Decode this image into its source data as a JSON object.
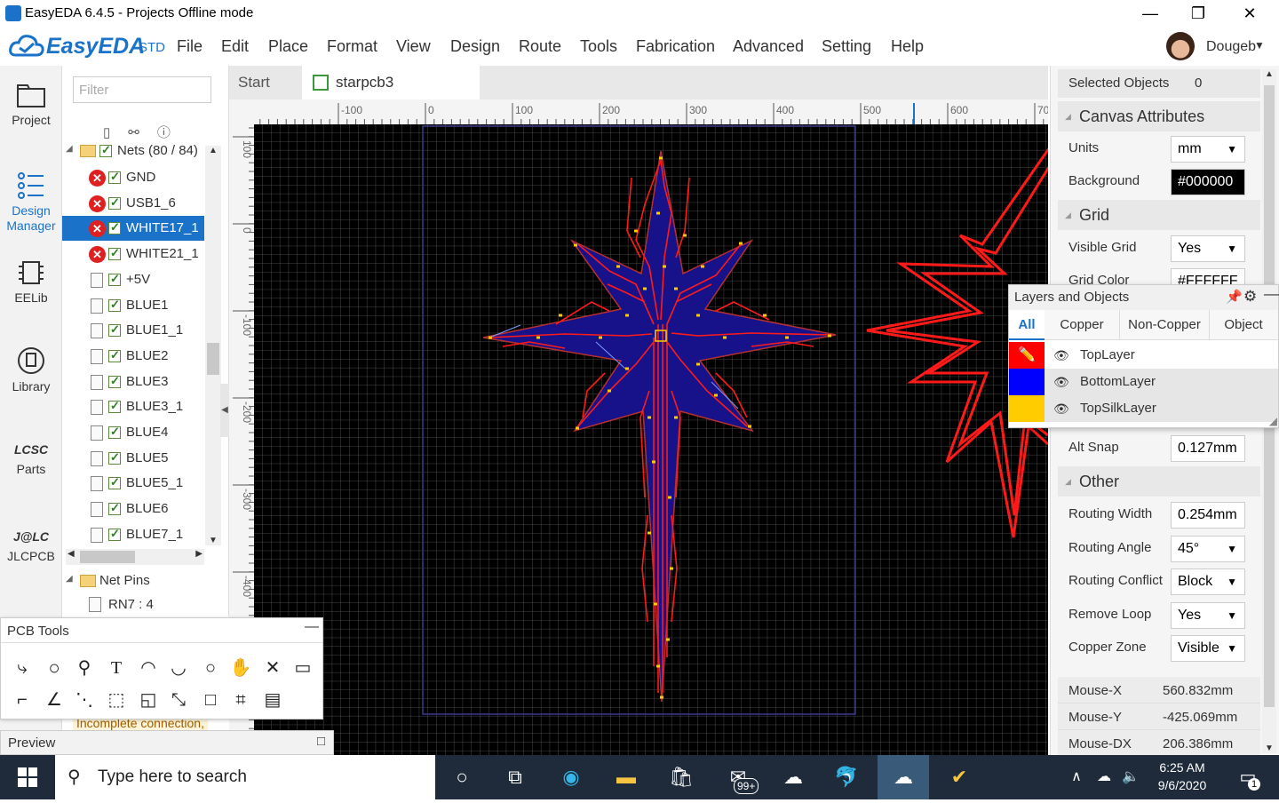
{
  "window": {
    "title": "EasyEDA 6.4.5 - Projects Offline mode",
    "min": "—",
    "max": "❐",
    "close": "✕"
  },
  "menubar": {
    "logo": "EasyEDA",
    "edition": "STD",
    "items": [
      "File",
      "Edit",
      "Place",
      "Format",
      "View",
      "Design",
      "Route",
      "Tools",
      "Fabrication",
      "Advanced",
      "Setting",
      "Help"
    ],
    "user": "Dougeb"
  },
  "leftnav": [
    {
      "label": "Project",
      "icon": "folder-icon"
    },
    {
      "label": "Design Manager",
      "icon": "design-manager-icon"
    },
    {
      "label": "EELib",
      "icon": "chip-icon"
    },
    {
      "label": "Library",
      "icon": "library-icon"
    },
    {
      "label": "Parts",
      "icon": "lcsc-icon"
    },
    {
      "label": "JLCPCB",
      "icon": "jlc-icon"
    }
  ],
  "design_manager": {
    "filter_placeholder": "Filter",
    "nets_header": "Nets (80 / 84)",
    "nets": [
      {
        "name": "GND",
        "error": true
      },
      {
        "name": "USB1_6",
        "error": true
      },
      {
        "name": "WHITE17_1",
        "error": true,
        "selected": true
      },
      {
        "name": "WHITE21_1",
        "error": true
      },
      {
        "name": "+5V",
        "error": false
      },
      {
        "name": "BLUE1",
        "error": false
      },
      {
        "name": "BLUE1_1",
        "error": false
      },
      {
        "name": "BLUE2",
        "error": false
      },
      {
        "name": "BLUE3",
        "error": false
      },
      {
        "name": "BLUE3_1",
        "error": false
      },
      {
        "name": "BLUE4",
        "error": false
      },
      {
        "name": "BLUE5",
        "error": false
      },
      {
        "name": "BLUE5_1",
        "error": false
      },
      {
        "name": "BLUE6",
        "error": false
      },
      {
        "name": "BLUE7_1",
        "error": false
      }
    ],
    "net_pins_header": "Net Pins",
    "net_pin": "RN7 : 4",
    "status_text": "Incomplete connection,"
  },
  "tabs": [
    {
      "label": "Start"
    },
    {
      "label": "starpcb3",
      "active": true
    }
  ],
  "ruler": {
    "top": [
      "-100",
      "0",
      "100",
      "200",
      "300",
      "400",
      "500",
      "600",
      "70"
    ],
    "left": [
      "100",
      "0",
      "-100",
      "-200",
      "-300",
      "-400"
    ]
  },
  "right_panel": {
    "selected_objects_label": "Selected Objects",
    "selected_objects_value": "0",
    "canvas_attributes": "Canvas Attributes",
    "units_label": "Units",
    "units_value": "mm",
    "background_label": "Background",
    "background_value": "#000000",
    "grid_section": "Grid",
    "visible_grid_label": "Visible Grid",
    "visible_grid_value": "Yes",
    "grid_color_label": "Grid Color",
    "grid_color_value": "#FFFFFF",
    "alt_snap_label": "Alt Snap",
    "alt_snap_value": "0.127mm",
    "other_section": "Other",
    "routing_width_label": "Routing Width",
    "routing_width_value": "0.254mm",
    "routing_angle_label": "Routing Angle",
    "routing_angle_value": "45°",
    "routing_conflict_label": "Routing Conflict",
    "routing_conflict_value": "Block",
    "remove_loop_label": "Remove Loop",
    "remove_loop_value": "Yes",
    "copper_zone_label": "Copper Zone",
    "copper_zone_value": "Visible",
    "mouse_x_label": "Mouse-X",
    "mouse_x_value": "560.832mm",
    "mouse_y_label": "Mouse-Y",
    "mouse_y_value": "-425.069mm",
    "mouse_dx_label": "Mouse-DX",
    "mouse_dx_value": "206.386mm"
  },
  "layers_panel": {
    "title": "Layers and Objects",
    "tabs": [
      "All",
      "Copper",
      "Non-Copper",
      "Object"
    ],
    "layers": [
      {
        "name": "TopLayer",
        "color": "#FF0000"
      },
      {
        "name": "BottomLayer",
        "color": "#0000FF"
      },
      {
        "name": "TopSilkLayer",
        "color": "#FFCC00"
      }
    ]
  },
  "pcb_tools": {
    "title": "PCB Tools"
  },
  "preview": {
    "title": "Preview"
  },
  "taskbar": {
    "search_placeholder": "Type here to search",
    "mail_badge": "99+",
    "time": "6:25 AM",
    "date": "9/6/2020",
    "notif_count": "1"
  }
}
